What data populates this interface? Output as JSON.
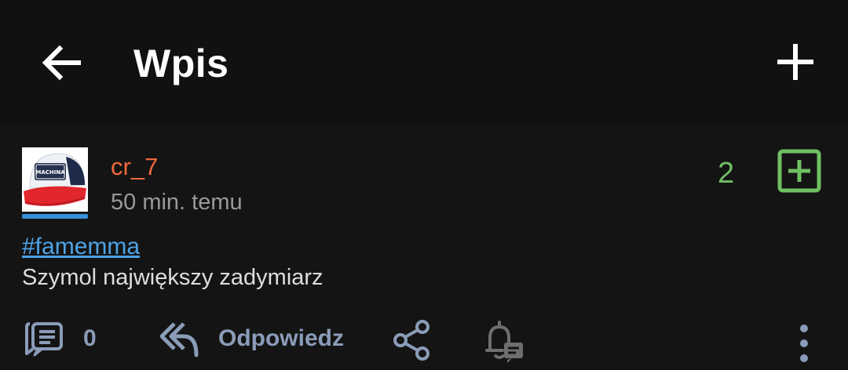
{
  "appbar": {
    "title": "Wpis",
    "back_icon": "arrow-back-icon",
    "add_icon": "plus-icon"
  },
  "post": {
    "username": "cr_7",
    "time_ago": "50 min. temu",
    "votes": "2",
    "tag": "#famemma",
    "text": "Szymol największy zadymiarz",
    "avatar_text": "MACHINA"
  },
  "actions": {
    "comments_count": "0",
    "reply_label": "Odpowiedz"
  },
  "colors": {
    "background": "#121212",
    "username": "#f0683a",
    "vote": "#6fbf63",
    "link": "#4ea3e6",
    "action": "#8a9cb8"
  }
}
